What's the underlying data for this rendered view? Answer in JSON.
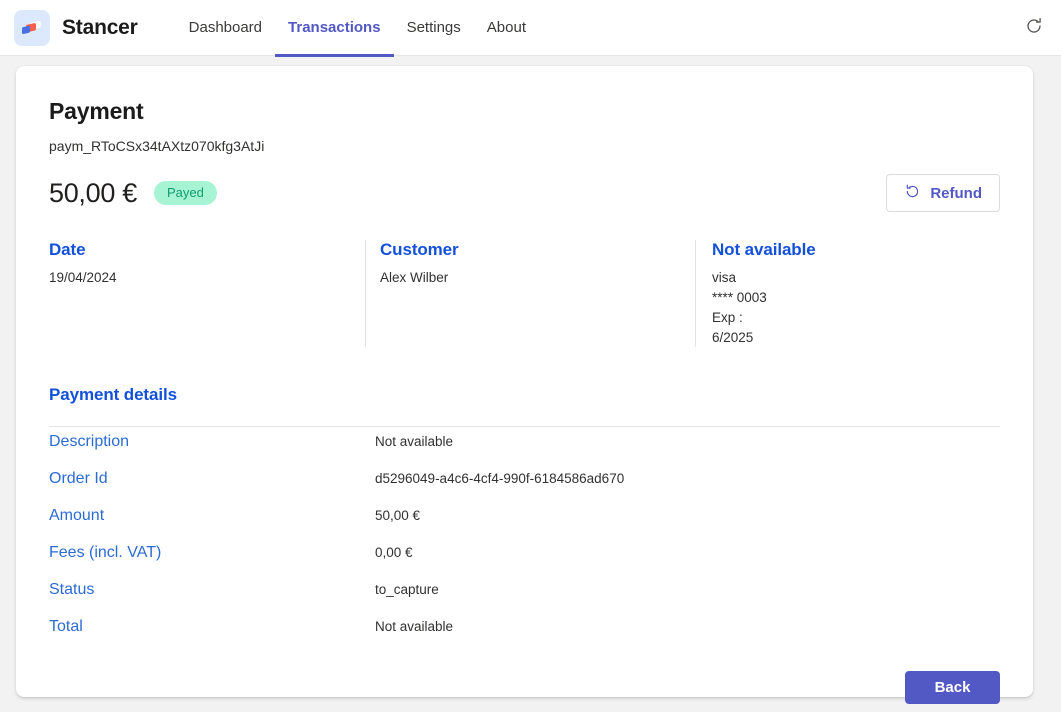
{
  "header": {
    "brand": "Stancer",
    "logo_icon": "stancer-cards-logo",
    "nav": [
      {
        "label": "Dashboard",
        "active": false
      },
      {
        "label": "Transactions",
        "active": true
      },
      {
        "label": "Settings",
        "active": false
      },
      {
        "label": "About",
        "active": false
      }
    ],
    "refresh_icon": "refresh-icon",
    "accent_color": "#5258c4"
  },
  "payment": {
    "title": "Payment",
    "id": "paym_RToCSx34tAXtz070kfg3AtJi",
    "amount": "50,00 €",
    "status_badge": "Payed",
    "badge_bg": "#a6f4d4",
    "badge_fg": "#0f9e6e",
    "refund_label": "Refund",
    "refund_icon": "refund-undo-icon"
  },
  "info_columns": {
    "date": {
      "title": "Date",
      "value": "19/04/2024"
    },
    "customer": {
      "title": "Customer",
      "value": "Alex Wilber"
    },
    "card": {
      "title": "Not available",
      "brand": "visa",
      "number": "**** 0003",
      "exp_label": "Exp :",
      "exp_value": "6/2025"
    }
  },
  "details": {
    "title": "Payment details",
    "rows": [
      {
        "label": "Description",
        "value": "Not available"
      },
      {
        "label": "Order Id",
        "value": "d5296049-a4c6-4cf4-990f-6184586ad670"
      },
      {
        "label": "Amount",
        "value": "50,00 €"
      },
      {
        "label": "Fees (incl. VAT)",
        "value": "0,00 €"
      },
      {
        "label": "Status",
        "value": "to_capture"
      },
      {
        "label": "Total",
        "value": "Not available"
      }
    ]
  },
  "footer": {
    "back_label": "Back"
  }
}
